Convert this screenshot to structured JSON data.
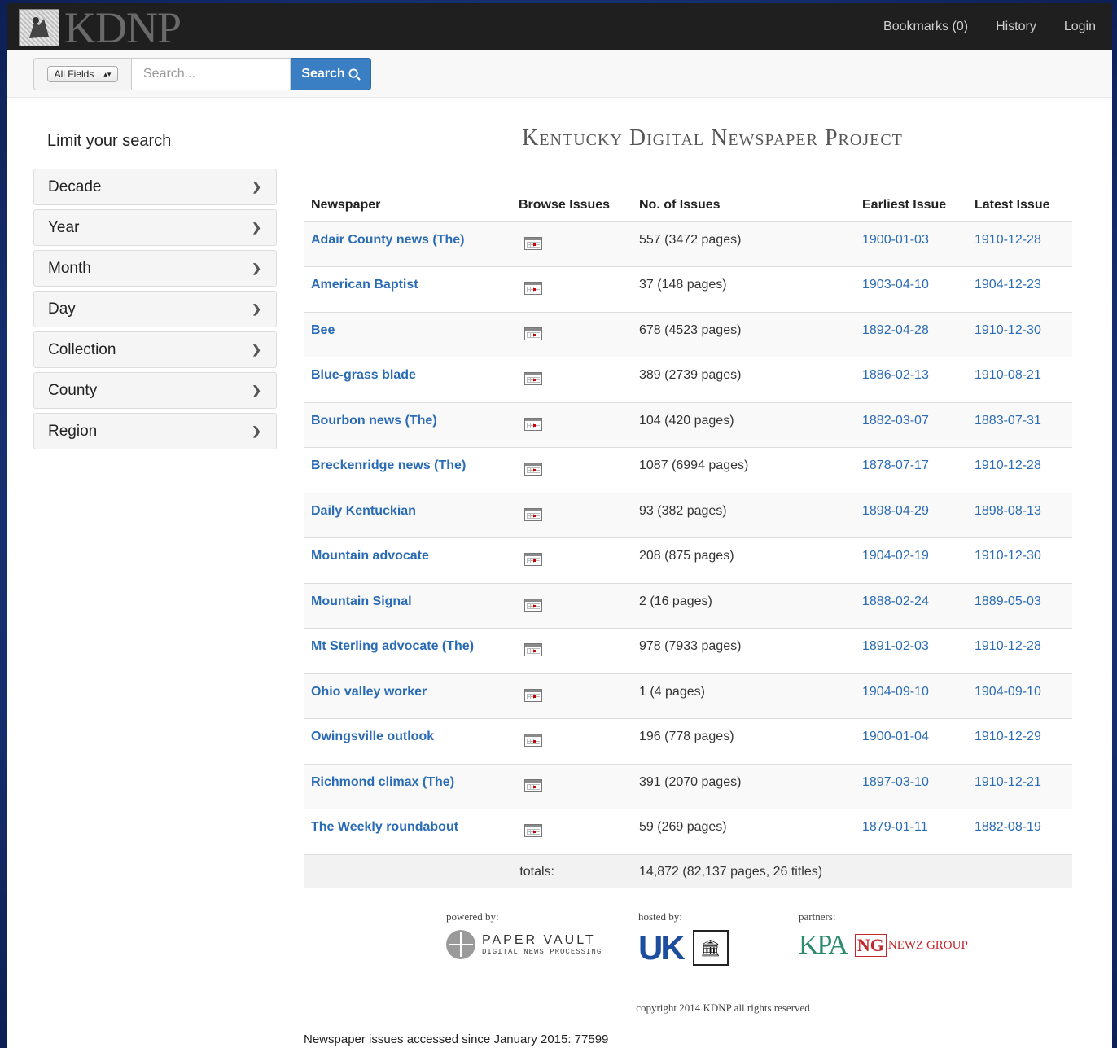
{
  "navbar": {
    "brand": "KDNP",
    "links": [
      "Bookmarks (0)",
      "History",
      "Login"
    ]
  },
  "search": {
    "field": "All Fields",
    "placeholder": "Search...",
    "button": "Search"
  },
  "sidebar": {
    "heading": "Limit your search",
    "facets": [
      "Decade",
      "Year",
      "Month",
      "Day",
      "Collection",
      "County",
      "Region"
    ]
  },
  "main": {
    "title": "Kentucky Digital Newspaper Project",
    "table": {
      "headers": [
        "Newspaper",
        "Browse Issues",
        "No. of Issues",
        "Earliest Issue",
        "Latest Issue"
      ],
      "rows": [
        {
          "name": "Adair County news (The)",
          "issues": "557 (3472 pages)",
          "earliest": "1900-01-03",
          "latest": "1910-12-28"
        },
        {
          "name": "American Baptist",
          "issues": "37 (148 pages)",
          "earliest": "1903-04-10",
          "latest": "1904-12-23"
        },
        {
          "name": "Bee",
          "issues": "678 (4523 pages)",
          "earliest": "1892-04-28",
          "latest": "1910-12-30"
        },
        {
          "name": "Blue-grass blade",
          "issues": "389 (2739 pages)",
          "earliest": "1886-02-13",
          "latest": "1910-08-21"
        },
        {
          "name": "Bourbon news (The)",
          "issues": "104 (420 pages)",
          "earliest": "1882-03-07",
          "latest": "1883-07-31"
        },
        {
          "name": "Breckenridge news (The)",
          "issues": "1087 (6994 pages)",
          "earliest": "1878-07-17",
          "latest": "1910-12-28"
        },
        {
          "name": "Daily Kentuckian",
          "issues": "93 (382 pages)",
          "earliest": "1898-04-29",
          "latest": "1898-08-13"
        },
        {
          "name": "Mountain advocate",
          "issues": "208 (875 pages)",
          "earliest": "1904-02-19",
          "latest": "1910-12-30"
        },
        {
          "name": "Mountain Signal",
          "issues": "2 (16 pages)",
          "earliest": "1888-02-24",
          "latest": "1889-05-03"
        },
        {
          "name": "Mt Sterling advocate (The)",
          "issues": "978 (7933 pages)",
          "earliest": "1891-02-03",
          "latest": "1910-12-28"
        },
        {
          "name": "Ohio valley worker",
          "issues": "1 (4 pages)",
          "earliest": "1904-09-10",
          "latest": "1904-09-10"
        },
        {
          "name": "Owingsville outlook",
          "issues": "196 (778 pages)",
          "earliest": "1900-01-04",
          "latest": "1910-12-29"
        },
        {
          "name": "Richmond climax (The)",
          "issues": "391 (2070 pages)",
          "earliest": "1897-03-10",
          "latest": "1910-12-21"
        },
        {
          "name": "The Weekly roundabout",
          "issues": "59 (269 pages)",
          "earliest": "1879-01-11",
          "latest": "1882-08-19"
        }
      ],
      "totals_label": "totals:",
      "totals_value": "14,872 (82,137 pages, 26 titles)"
    }
  },
  "footer": {
    "powered_by": "powered by:",
    "paper_vault_name": "PAPER VAULT",
    "paper_vault_sub": "DIGITAL NEWS PROCESSING",
    "hosted_by": "hosted by:",
    "uk_mark": "UK",
    "partners": "partners:",
    "kpa_mark": "KPA",
    "ng_mark": "NG",
    "newz_group": "NEWZ GROUP",
    "copyright": "copyright 2014 KDNP all rights reserved",
    "accessed": "Newspaper issues accessed since January 2015: 77599"
  },
  "colors": {
    "link": "#2a6bb5",
    "search_button": "#3a7ec4",
    "navbar": "#1f1f1f"
  }
}
